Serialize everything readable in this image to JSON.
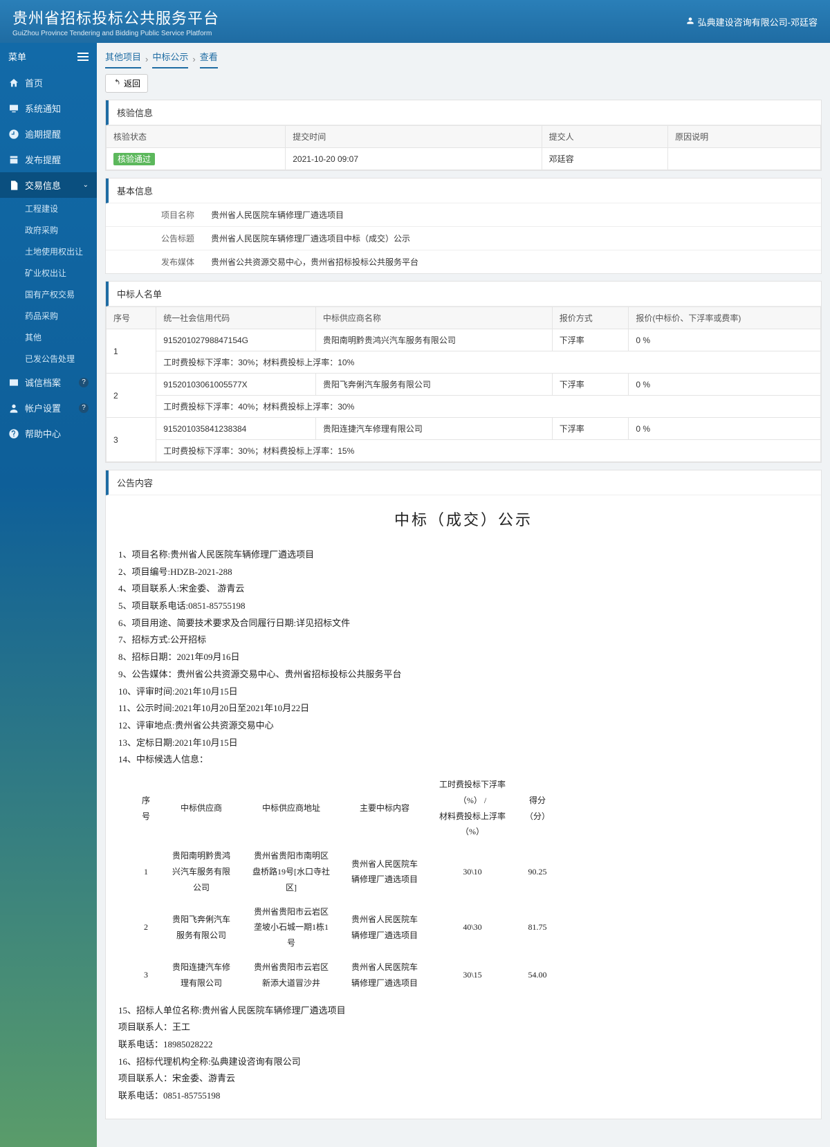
{
  "header": {
    "title": "贵州省招标投标公共服务平台",
    "subtitle": "GuiZhou Province Tendering and Bidding Public Service Platform",
    "user": "弘典建设咨询有限公司-邓廷容"
  },
  "sidebar": {
    "menu_label": "菜单",
    "items": [
      {
        "icon": "home",
        "label": "首页"
      },
      {
        "icon": "monitor",
        "label": "系统通知"
      },
      {
        "icon": "clock",
        "label": "逾期提醒"
      },
      {
        "icon": "publish",
        "label": "发布提醒"
      },
      {
        "icon": "doc",
        "label": "交易信息",
        "active": true,
        "expand": true
      },
      {
        "icon": "card",
        "label": "诚信档案",
        "badge": "?"
      },
      {
        "icon": "user",
        "label": "帐户设置",
        "badge": "?"
      },
      {
        "icon": "help",
        "label": "帮助中心"
      }
    ],
    "sub_items": [
      "工程建设",
      "政府采购",
      "土地使用权出让",
      "矿业权出让",
      "国有产权交易",
      "药品采购",
      "其他",
      "已发公告处理"
    ]
  },
  "breadcrumbs": [
    "其他项目",
    "中标公示",
    "查看"
  ],
  "back_label": "返回",
  "verify": {
    "title": "核验信息",
    "headers": [
      "核验状态",
      "提交时间",
      "提交人",
      "原因说明"
    ],
    "row": {
      "status": "核验通过",
      "time": "2021-10-20 09:07",
      "submitter": "邓廷容",
      "reason": ""
    }
  },
  "basic": {
    "title": "基本信息",
    "rows": [
      {
        "label": "项目名称",
        "value": "贵州省人民医院车辆修理厂遴选项目"
      },
      {
        "label": "公告标题",
        "value": "贵州省人民医院车辆修理厂遴选项目中标（成交）公示"
      },
      {
        "label": "发布媒体",
        "value": "贵州省公共资源交易中心，贵州省招标投标公共服务平台"
      }
    ]
  },
  "winners": {
    "title": "中标人名单",
    "headers": [
      "序号",
      "统一社会信用代码",
      "中标供应商名称",
      "报价方式",
      "报价(中标价、下浮率或费率)"
    ],
    "rows": [
      {
        "seq": "1",
        "code": "91520102798847154G",
        "name": "贵阳南明黔贵鸿兴汽车服务有限公司",
        "method": "下浮率",
        "price": "0 %",
        "note": "工时费投标下浮率：30%；材料费投标上浮率：10%"
      },
      {
        "seq": "2",
        "code": "91520103061005577X",
        "name": "贵阳飞奔俐汽车服务有限公司",
        "method": "下浮率",
        "price": "0 %",
        "note": "工时费投标下浮率：40%；材料费投标上浮率：30%"
      },
      {
        "seq": "3",
        "code": "915201035841238384",
        "name": "贵阳连捷汽车修理有限公司",
        "method": "下浮率",
        "price": "0 %",
        "note": "工时费投标下浮率：30%；材料费投标上浮率：15%"
      }
    ]
  },
  "announcement": {
    "section_title": "公告内容",
    "heading": "中标（成交）公示",
    "lines": [
      "1、项目名称:贵州省人民医院车辆修理厂遴选项目",
      "2、项目编号:HDZB-2021-288",
      "4、项目联系人:宋金委、 游青云",
      "5、项目联系电话:0851-85755198",
      "6、项目用途、简要技术要求及合同履行日期:详见招标文件",
      "7、招标方式:公开招标",
      "8、招标日期：2021年09月16日",
      "9、公告媒体：贵州省公共资源交易中心、贵州省招标投标公共服务平台",
      "10、评审时间:2021年10月15日",
      "11、公示时间:2021年10月20日至2021年10月22日",
      "12、评审地点:贵州省公共资源交易中心",
      "13、定标日期:2021年10月15日",
      "14、中标候选人信息："
    ],
    "table": {
      "headers": [
        "序号",
        "中标供应商",
        "中标供应商地址",
        "主要中标内容",
        "工时费投标下浮率（%） / 材料费投标上浮率（%）",
        "得分（分）"
      ],
      "rows": [
        {
          "seq": "1",
          "supplier": "贵阳南明黔贵鸿兴汽车服务有限公司",
          "addr": "贵州省贵阳市南明区盘桥路19号[水口寺社区]",
          "content": "贵州省人民医院车辆修理厂遴选项目",
          "rate": "30\\10",
          "score": "90.25"
        },
        {
          "seq": "2",
          "supplier": "贵阳飞奔俐汽车服务有限公司",
          "addr": "贵州省贵阳市云岩区垄坡小石城一期1栋1号",
          "content": "贵州省人民医院车辆修理厂遴选项目",
          "rate": "40\\30",
          "score": "81.75"
        },
        {
          "seq": "3",
          "supplier": "贵阳连捷汽车修理有限公司",
          "addr": "贵州省贵阳市云岩区新添大道冒沙井",
          "content": "贵州省人民医院车辆修理厂遴选项目",
          "rate": "30\\15",
          "score": "54.00"
        }
      ]
    },
    "footer_lines": [
      "15、招标人单位名称:贵州省人民医院车辆修理厂遴选项目",
      "项目联系人：王工",
      "联系电话：18985028222",
      "16、招标代理机构全称:弘典建设咨询有限公司",
      "项目联系人：宋金委、游青云",
      "联系电话：0851-85755198"
    ]
  }
}
